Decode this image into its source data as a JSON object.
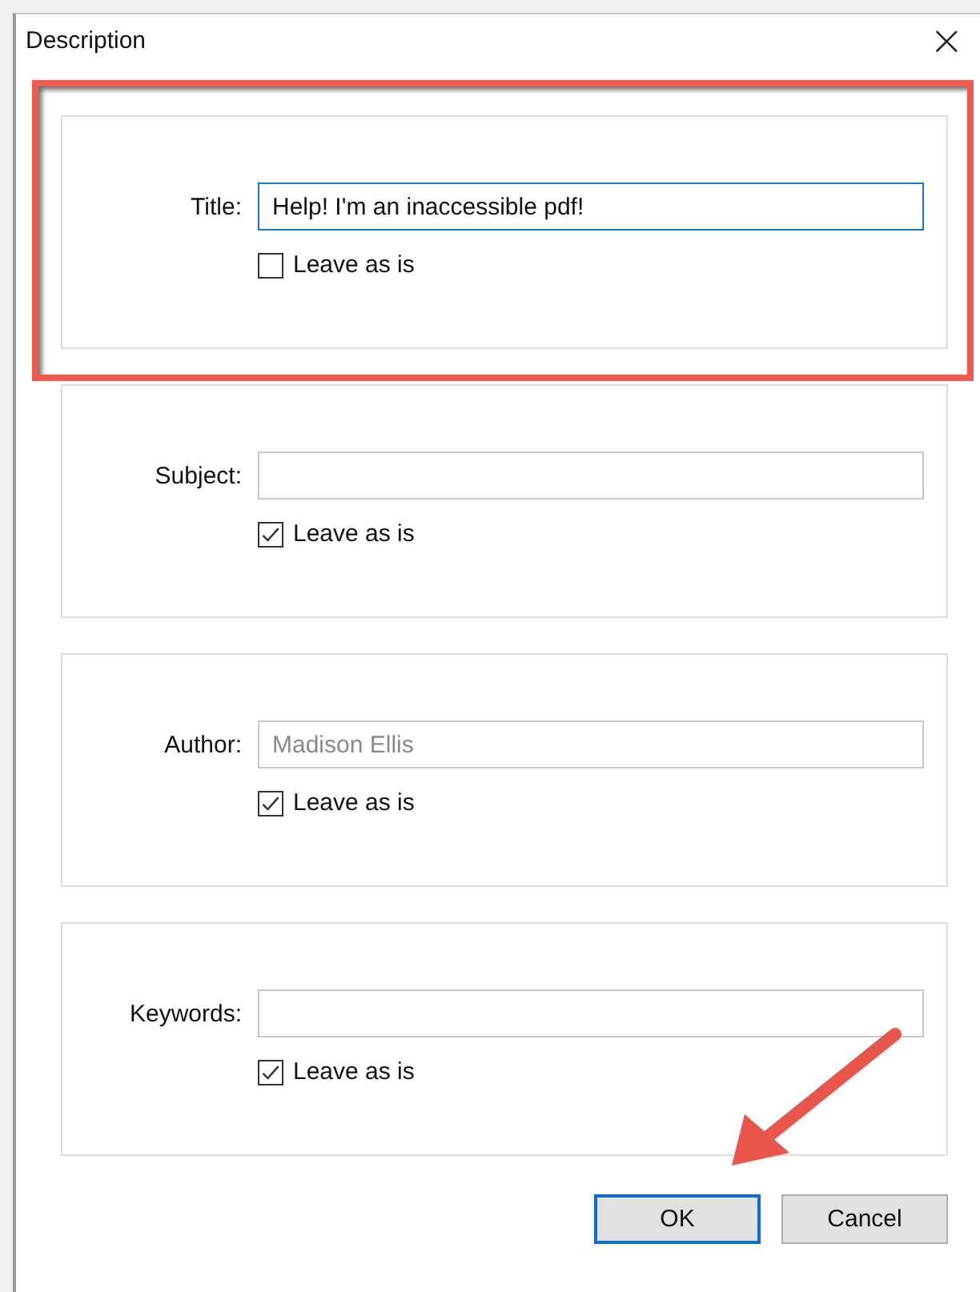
{
  "window": {
    "title": "Description",
    "close": "×"
  },
  "groups": [
    {
      "label": "Title:",
      "value": "Help! I'm an inaccessible pdf!",
      "focused": true,
      "disabled": false,
      "highlighted": true,
      "checkbox": {
        "label": "Leave as is",
        "checked": false
      }
    },
    {
      "label": "Subject:",
      "focused": false,
      "disabled": false,
      "highlighted": false,
      "checkbox": {
        "label": "Leave as is",
        "checked": true
      }
    },
    {
      "label": "Author:",
      "value": "Madison Ellis",
      "focused": false,
      "disabled": true,
      "highlighted": false,
      "checkbox": {
        "label": "Leave as is",
        "checked": true
      }
    },
    {
      "label": "Keywords:",
      "focused": false,
      "disabled": false,
      "highlighted": false,
      "checkbox": {
        "label": "Leave as is",
        "checked": true
      }
    }
  ],
  "buttons": [
    {
      "label": "OK",
      "default": true
    },
    {
      "label": "Cancel",
      "default": false
    }
  ]
}
